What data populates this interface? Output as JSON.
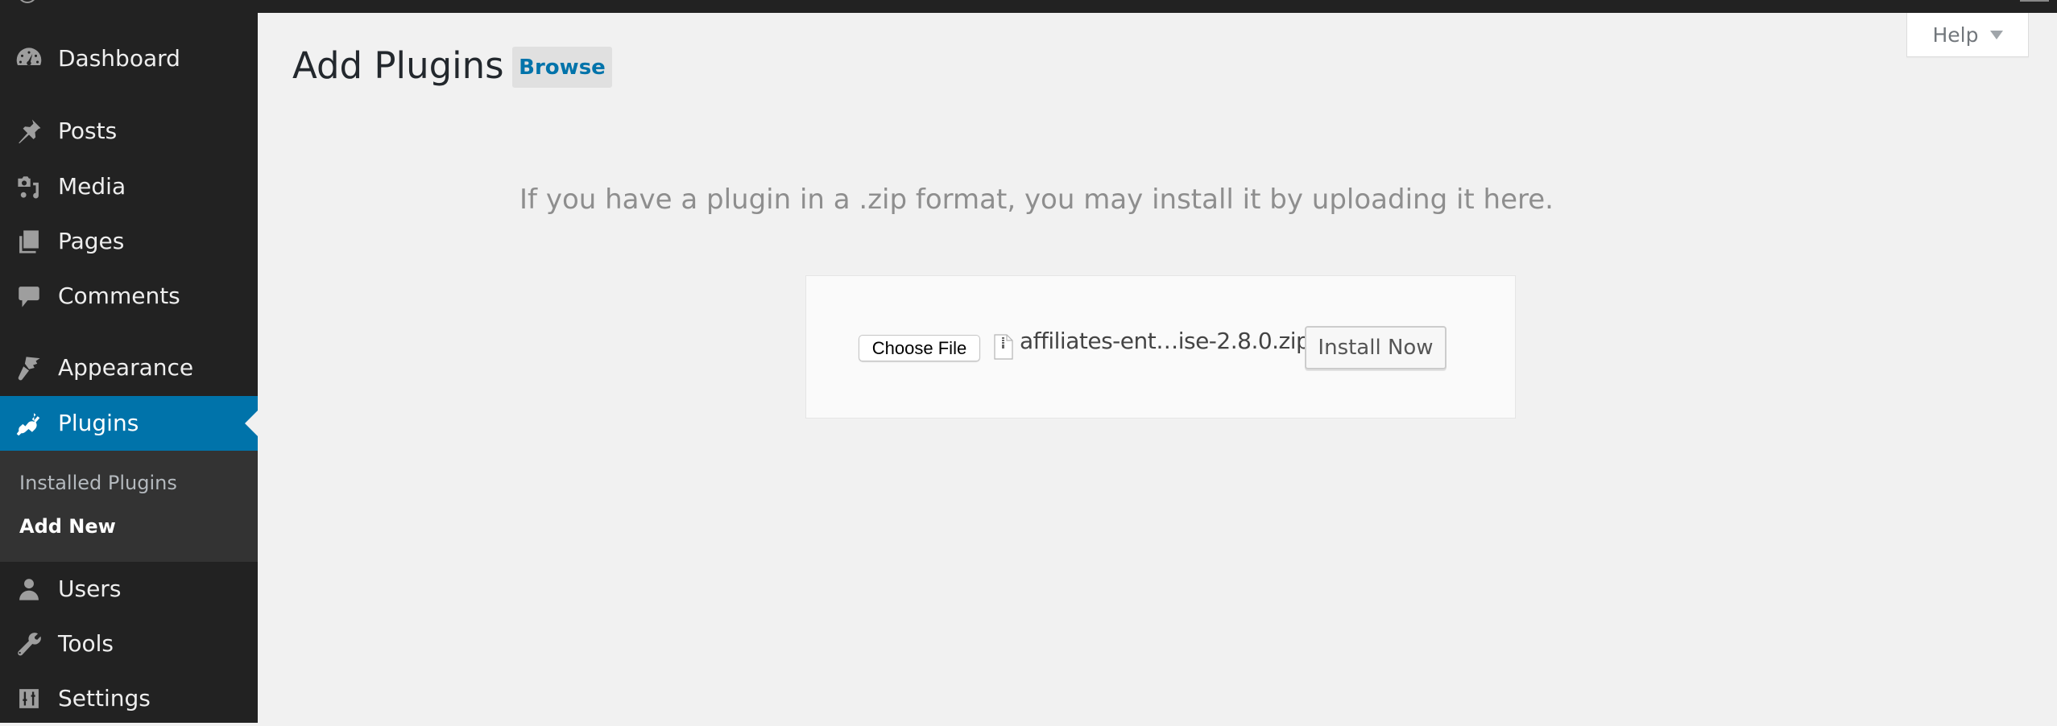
{
  "sidebar": {
    "items": [
      {
        "label": "Dashboard",
        "icon": "dashboard-icon"
      },
      {
        "label": "Posts",
        "icon": "pin-icon"
      },
      {
        "label": "Media",
        "icon": "media-icon"
      },
      {
        "label": "Pages",
        "icon": "pages-icon"
      },
      {
        "label": "Comments",
        "icon": "comment-icon"
      },
      {
        "label": "Appearance",
        "icon": "paintbrush-icon"
      },
      {
        "label": "Plugins",
        "icon": "plug-icon",
        "current": true
      },
      {
        "label": "Users",
        "icon": "user-icon"
      },
      {
        "label": "Tools",
        "icon": "wrench-icon"
      },
      {
        "label": "Settings",
        "icon": "sliders-icon"
      }
    ],
    "submenu": [
      {
        "label": "Installed Plugins"
      },
      {
        "label": "Add New",
        "current": true
      }
    ]
  },
  "header": {
    "title": "Add Plugins",
    "browse_label": "Browse",
    "help_label": "Help"
  },
  "upload": {
    "intro": "If you have a plugin in a .zip format, you may install it by uploading it here.",
    "choose_file_label": "Choose File",
    "file_name": "affiliates-ent…ise-2.8.0.zip",
    "install_label": "Install Now"
  },
  "colors": {
    "accent": "#0073aa",
    "sidebar_bg": "#222222",
    "submenu_bg": "#333333",
    "page_bg": "#f1f1f1"
  }
}
